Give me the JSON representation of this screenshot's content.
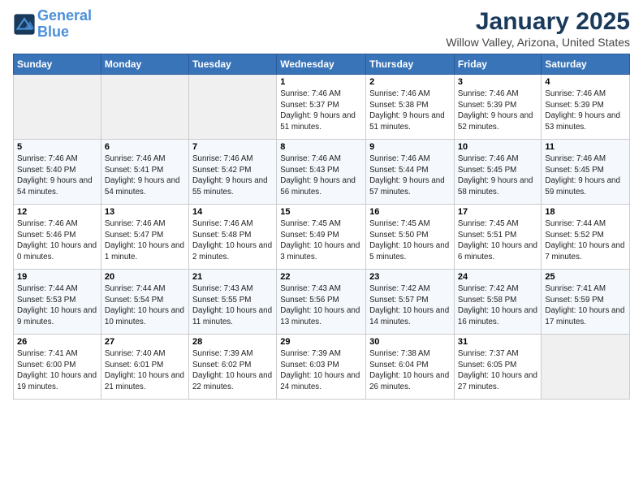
{
  "header": {
    "logo_line1": "General",
    "logo_line2": "Blue",
    "month": "January 2025",
    "location": "Willow Valley, Arizona, United States"
  },
  "days_of_week": [
    "Sunday",
    "Monday",
    "Tuesday",
    "Wednesday",
    "Thursday",
    "Friday",
    "Saturday"
  ],
  "weeks": [
    [
      {
        "day": "",
        "info": ""
      },
      {
        "day": "",
        "info": ""
      },
      {
        "day": "",
        "info": ""
      },
      {
        "day": "1",
        "info": "Sunrise: 7:46 AM\nSunset: 5:37 PM\nDaylight: 9 hours and 51 minutes."
      },
      {
        "day": "2",
        "info": "Sunrise: 7:46 AM\nSunset: 5:38 PM\nDaylight: 9 hours and 51 minutes."
      },
      {
        "day": "3",
        "info": "Sunrise: 7:46 AM\nSunset: 5:39 PM\nDaylight: 9 hours and 52 minutes."
      },
      {
        "day": "4",
        "info": "Sunrise: 7:46 AM\nSunset: 5:39 PM\nDaylight: 9 hours and 53 minutes."
      }
    ],
    [
      {
        "day": "5",
        "info": "Sunrise: 7:46 AM\nSunset: 5:40 PM\nDaylight: 9 hours and 54 minutes."
      },
      {
        "day": "6",
        "info": "Sunrise: 7:46 AM\nSunset: 5:41 PM\nDaylight: 9 hours and 54 minutes."
      },
      {
        "day": "7",
        "info": "Sunrise: 7:46 AM\nSunset: 5:42 PM\nDaylight: 9 hours and 55 minutes."
      },
      {
        "day": "8",
        "info": "Sunrise: 7:46 AM\nSunset: 5:43 PM\nDaylight: 9 hours and 56 minutes."
      },
      {
        "day": "9",
        "info": "Sunrise: 7:46 AM\nSunset: 5:44 PM\nDaylight: 9 hours and 57 minutes."
      },
      {
        "day": "10",
        "info": "Sunrise: 7:46 AM\nSunset: 5:45 PM\nDaylight: 9 hours and 58 minutes."
      },
      {
        "day": "11",
        "info": "Sunrise: 7:46 AM\nSunset: 5:45 PM\nDaylight: 9 hours and 59 minutes."
      }
    ],
    [
      {
        "day": "12",
        "info": "Sunrise: 7:46 AM\nSunset: 5:46 PM\nDaylight: 10 hours and 0 minutes."
      },
      {
        "day": "13",
        "info": "Sunrise: 7:46 AM\nSunset: 5:47 PM\nDaylight: 10 hours and 1 minute."
      },
      {
        "day": "14",
        "info": "Sunrise: 7:46 AM\nSunset: 5:48 PM\nDaylight: 10 hours and 2 minutes."
      },
      {
        "day": "15",
        "info": "Sunrise: 7:45 AM\nSunset: 5:49 PM\nDaylight: 10 hours and 3 minutes."
      },
      {
        "day": "16",
        "info": "Sunrise: 7:45 AM\nSunset: 5:50 PM\nDaylight: 10 hours and 5 minutes."
      },
      {
        "day": "17",
        "info": "Sunrise: 7:45 AM\nSunset: 5:51 PM\nDaylight: 10 hours and 6 minutes."
      },
      {
        "day": "18",
        "info": "Sunrise: 7:44 AM\nSunset: 5:52 PM\nDaylight: 10 hours and 7 minutes."
      }
    ],
    [
      {
        "day": "19",
        "info": "Sunrise: 7:44 AM\nSunset: 5:53 PM\nDaylight: 10 hours and 9 minutes."
      },
      {
        "day": "20",
        "info": "Sunrise: 7:44 AM\nSunset: 5:54 PM\nDaylight: 10 hours and 10 minutes."
      },
      {
        "day": "21",
        "info": "Sunrise: 7:43 AM\nSunset: 5:55 PM\nDaylight: 10 hours and 11 minutes."
      },
      {
        "day": "22",
        "info": "Sunrise: 7:43 AM\nSunset: 5:56 PM\nDaylight: 10 hours and 13 minutes."
      },
      {
        "day": "23",
        "info": "Sunrise: 7:42 AM\nSunset: 5:57 PM\nDaylight: 10 hours and 14 minutes."
      },
      {
        "day": "24",
        "info": "Sunrise: 7:42 AM\nSunset: 5:58 PM\nDaylight: 10 hours and 16 minutes."
      },
      {
        "day": "25",
        "info": "Sunrise: 7:41 AM\nSunset: 5:59 PM\nDaylight: 10 hours and 17 minutes."
      }
    ],
    [
      {
        "day": "26",
        "info": "Sunrise: 7:41 AM\nSunset: 6:00 PM\nDaylight: 10 hours and 19 minutes."
      },
      {
        "day": "27",
        "info": "Sunrise: 7:40 AM\nSunset: 6:01 PM\nDaylight: 10 hours and 21 minutes."
      },
      {
        "day": "28",
        "info": "Sunrise: 7:39 AM\nSunset: 6:02 PM\nDaylight: 10 hours and 22 minutes."
      },
      {
        "day": "29",
        "info": "Sunrise: 7:39 AM\nSunset: 6:03 PM\nDaylight: 10 hours and 24 minutes."
      },
      {
        "day": "30",
        "info": "Sunrise: 7:38 AM\nSunset: 6:04 PM\nDaylight: 10 hours and 26 minutes."
      },
      {
        "day": "31",
        "info": "Sunrise: 7:37 AM\nSunset: 6:05 PM\nDaylight: 10 hours and 27 minutes."
      },
      {
        "day": "",
        "info": ""
      }
    ]
  ]
}
